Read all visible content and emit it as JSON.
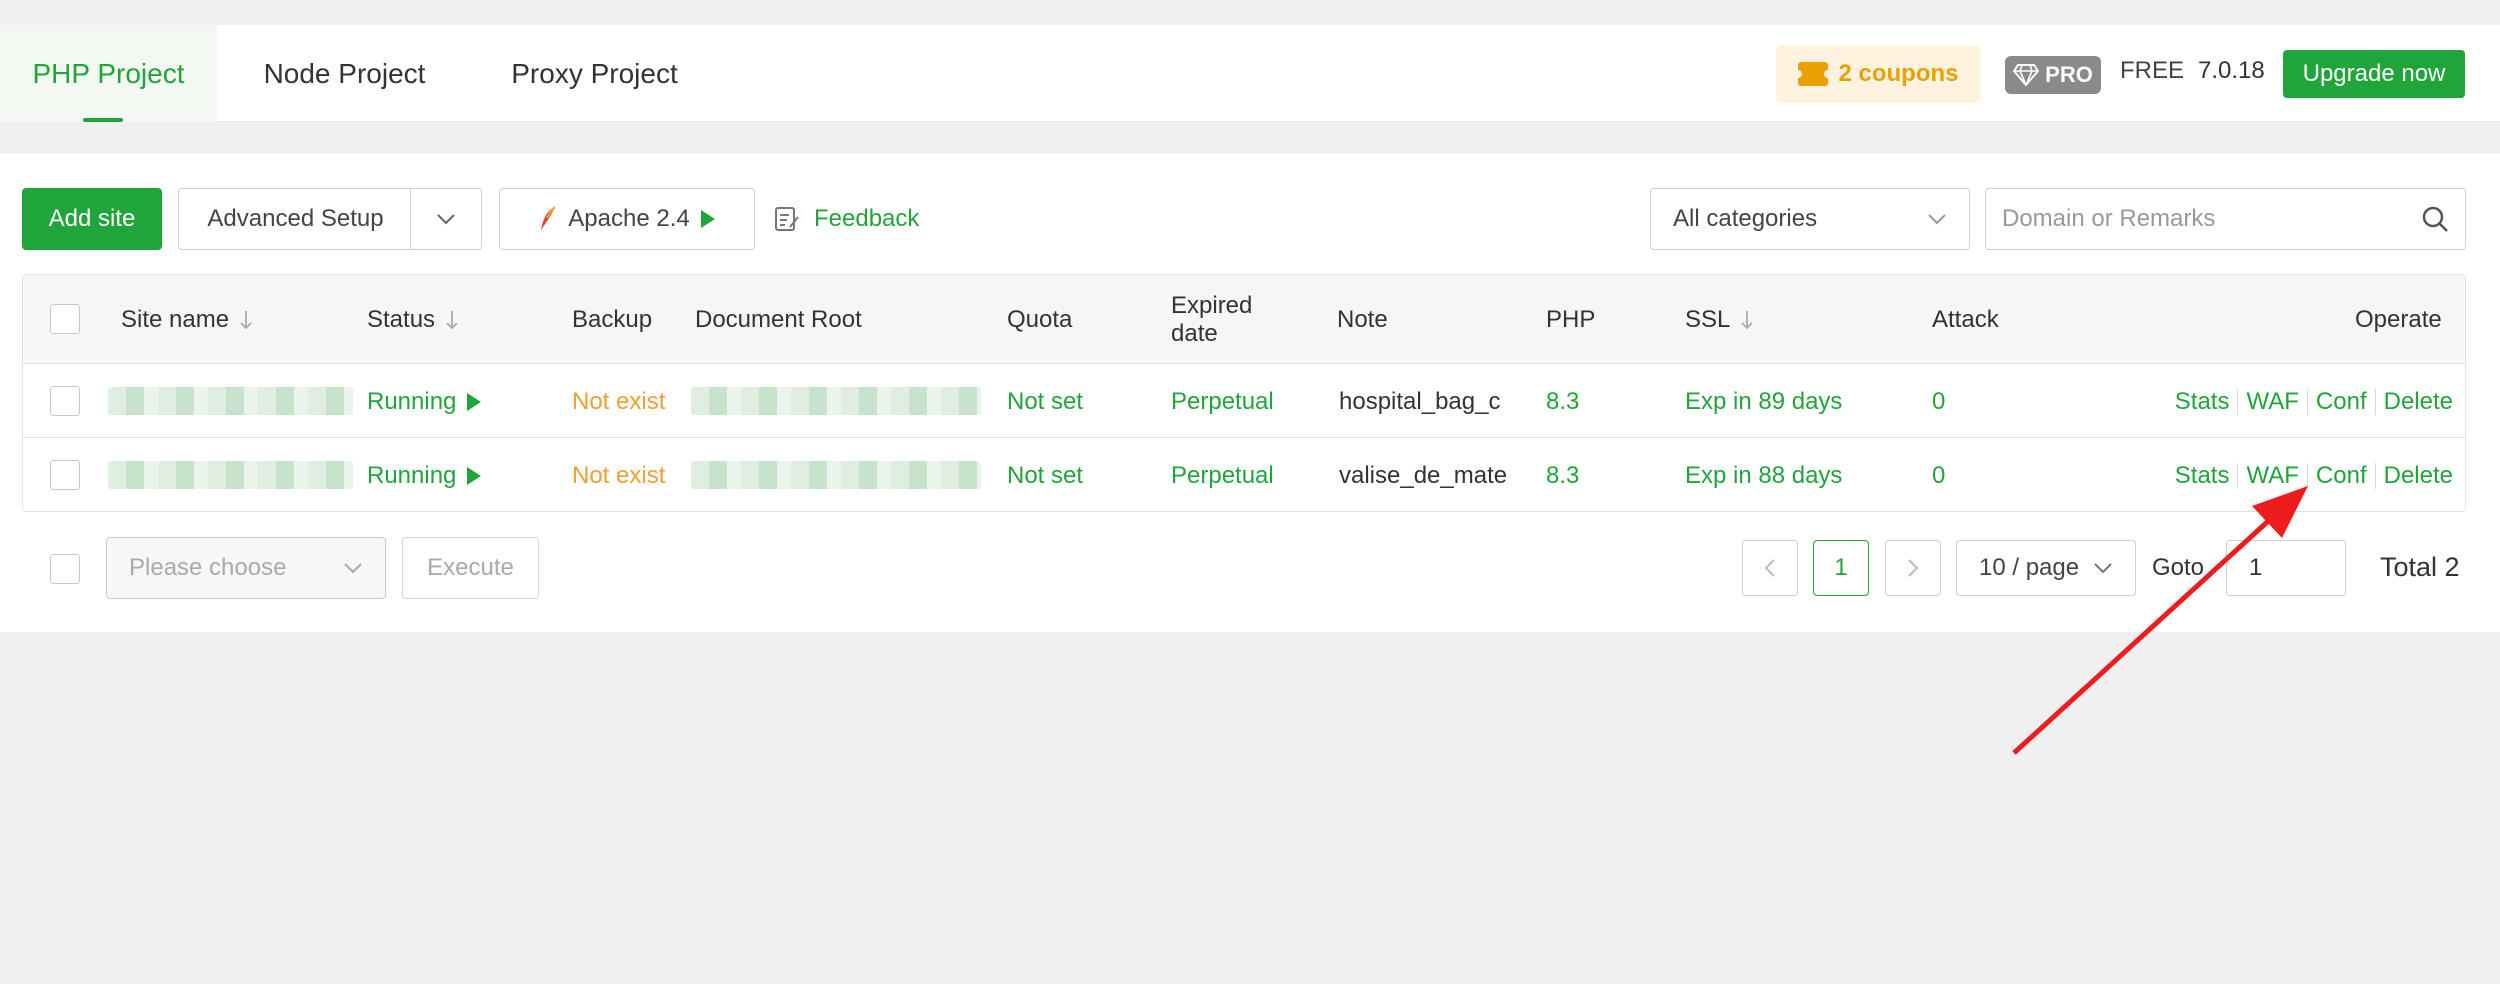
{
  "tabs": [
    {
      "label": "PHP Project",
      "active": true
    },
    {
      "label": "Node Project",
      "active": false
    },
    {
      "label": "Proxy Project",
      "active": false
    }
  ],
  "header": {
    "coupons": "2 coupons",
    "pro": "PRO",
    "free": "FREE",
    "version": "7.0.18",
    "upgrade": "Upgrade now"
  },
  "toolbar": {
    "add_site": "Add site",
    "advanced_setup": "Advanced Setup",
    "apache": "Apache 2.4",
    "feedback": "Feedback",
    "category": "All categories",
    "search_placeholder": "Domain or Remarks"
  },
  "table": {
    "columns": {
      "site_name": "Site name",
      "status": "Status",
      "backup": "Backup",
      "document_root": "Document Root",
      "quota": "Quota",
      "expired_line1": "Expired",
      "expired_line2": "date",
      "note": "Note",
      "php": "PHP",
      "ssl": "SSL",
      "attack": "Attack",
      "operate": "Operate"
    },
    "rows": [
      {
        "status": "Running",
        "backup": "Not exist",
        "quota": "Not set",
        "expired": "Perpetual",
        "note": "hospital_bag_c",
        "php": "8.3",
        "ssl": "Exp in 89 days",
        "attack": "0"
      },
      {
        "status": "Running",
        "backup": "Not exist",
        "quota": "Not set",
        "expired": "Perpetual",
        "note": "valise_de_mate",
        "php": "8.3",
        "ssl": "Exp in 88 days",
        "attack": "0"
      }
    ],
    "ops": {
      "stats": "Stats",
      "waf": "WAF",
      "conf": "Conf",
      "delete": "Delete"
    }
  },
  "footer": {
    "bulk_placeholder": "Please choose",
    "execute": "Execute",
    "current_page": "1",
    "per_page": "10 / page",
    "goto_label": "Goto",
    "goto_value": "1",
    "total": "Total 2"
  },
  "colors": {
    "accent": "#20a53a",
    "warning": "#f0a030",
    "coupon": "#eaa100",
    "annotation_arrow": "#ee1c1c"
  }
}
